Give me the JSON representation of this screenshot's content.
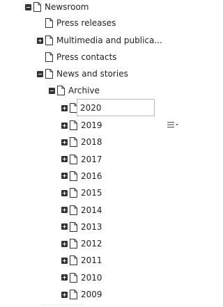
{
  "tree": {
    "root": {
      "label": "Newsroom"
    },
    "press_releases": {
      "label": "Press releases"
    },
    "multimedia": {
      "label": "Multimedia and publica..."
    },
    "press_contacts": {
      "label": "Press contacts"
    },
    "news_and_stories": {
      "label": "News and stories"
    },
    "archive": {
      "label": "Archive"
    },
    "editing_value": "2020",
    "years": [
      "2019",
      "2018",
      "2017",
      "2016",
      "2015",
      "2014",
      "2013",
      "2012",
      "2011",
      "2010",
      "2009"
    ]
  },
  "icons": {
    "page": "page-icon",
    "expand": "plus-icon",
    "collapse": "minus-icon",
    "menu": "list-menu-icon"
  }
}
